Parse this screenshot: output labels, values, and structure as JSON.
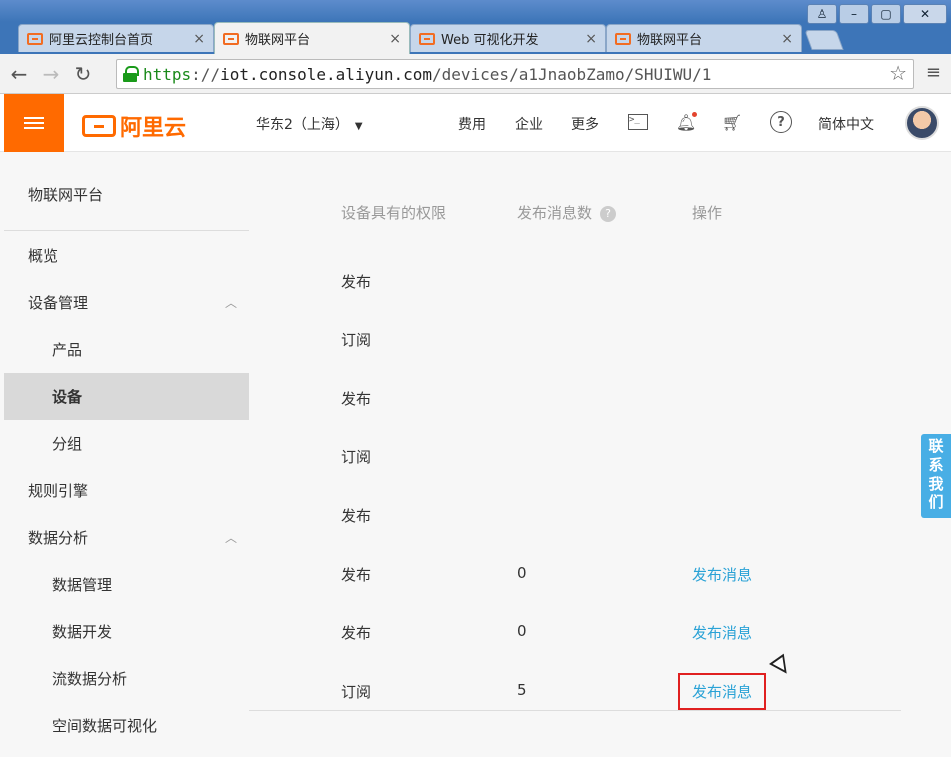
{
  "browser": {
    "tabs": [
      {
        "label": "阿里云控制台首页",
        "active": false
      },
      {
        "label": "物联网平台",
        "active": true
      },
      {
        "label": "Web 可视化开发",
        "active": false
      },
      {
        "label": "物联网平台",
        "active": false
      }
    ],
    "url_scheme": "https",
    "url_sep": "://",
    "url_host": "iot.console.aliyun.com",
    "url_path": "/devices/a1JnaobZamo/SHUIWU/1",
    "close_glyph": "×"
  },
  "header": {
    "logo_text": "阿里云",
    "region": "华东2（上海）",
    "nav": [
      "费用",
      "企业",
      "更多"
    ],
    "language": "简体中文",
    "icons": [
      "terminal-icon",
      "bell-icon",
      "cart-icon",
      "help-icon"
    ],
    "brand_color": "#ff6a00"
  },
  "sidebar": {
    "title": "物联网平台",
    "items": [
      {
        "label": "概览",
        "level": 1,
        "active": false
      },
      {
        "label": "设备管理",
        "level": 1,
        "active": false,
        "expanded": true
      },
      {
        "label": "产品",
        "level": 2,
        "active": false
      },
      {
        "label": "设备",
        "level": 2,
        "active": true
      },
      {
        "label": "分组",
        "level": 2,
        "active": false
      },
      {
        "label": "规则引擎",
        "level": 1,
        "active": false
      },
      {
        "label": "数据分析",
        "level": 1,
        "active": false,
        "expanded": true
      },
      {
        "label": "数据管理",
        "level": 2,
        "active": false
      },
      {
        "label": "数据开发",
        "level": 2,
        "active": false
      },
      {
        "label": "流数据分析",
        "level": 2,
        "active": false
      },
      {
        "label": "空间数据可视化",
        "level": 2,
        "active": false
      }
    ]
  },
  "table": {
    "headers": [
      "设备具有的权限",
      "发布消息数",
      "操作"
    ],
    "rows": [
      {
        "permission": "发布",
        "count": "",
        "action": ""
      },
      {
        "permission": "订阅",
        "count": "",
        "action": ""
      },
      {
        "permission": "发布",
        "count": "",
        "action": ""
      },
      {
        "permission": "订阅",
        "count": "",
        "action": ""
      },
      {
        "permission": "发布",
        "count": "",
        "action": ""
      },
      {
        "permission": "发布",
        "count": "0",
        "action": "发布消息"
      },
      {
        "permission": "发布",
        "count": "0",
        "action": "发布消息"
      },
      {
        "permission": "订阅",
        "count": "5",
        "action": "发布消息",
        "highlighted": true
      }
    ],
    "link_color": "#2aa2d6",
    "highlight_color": "#e02020"
  },
  "contact": {
    "label": "联系我们",
    "chars": [
      "联",
      "系",
      "我",
      "们"
    ]
  },
  "window_controls": {
    "account": "♙",
    "minimize": "–",
    "maximize": "▢",
    "close": "✕"
  },
  "nav_icons": {
    "back": "←",
    "forward": "→",
    "reload": "↻",
    "star": "☆",
    "menu": "≡"
  }
}
